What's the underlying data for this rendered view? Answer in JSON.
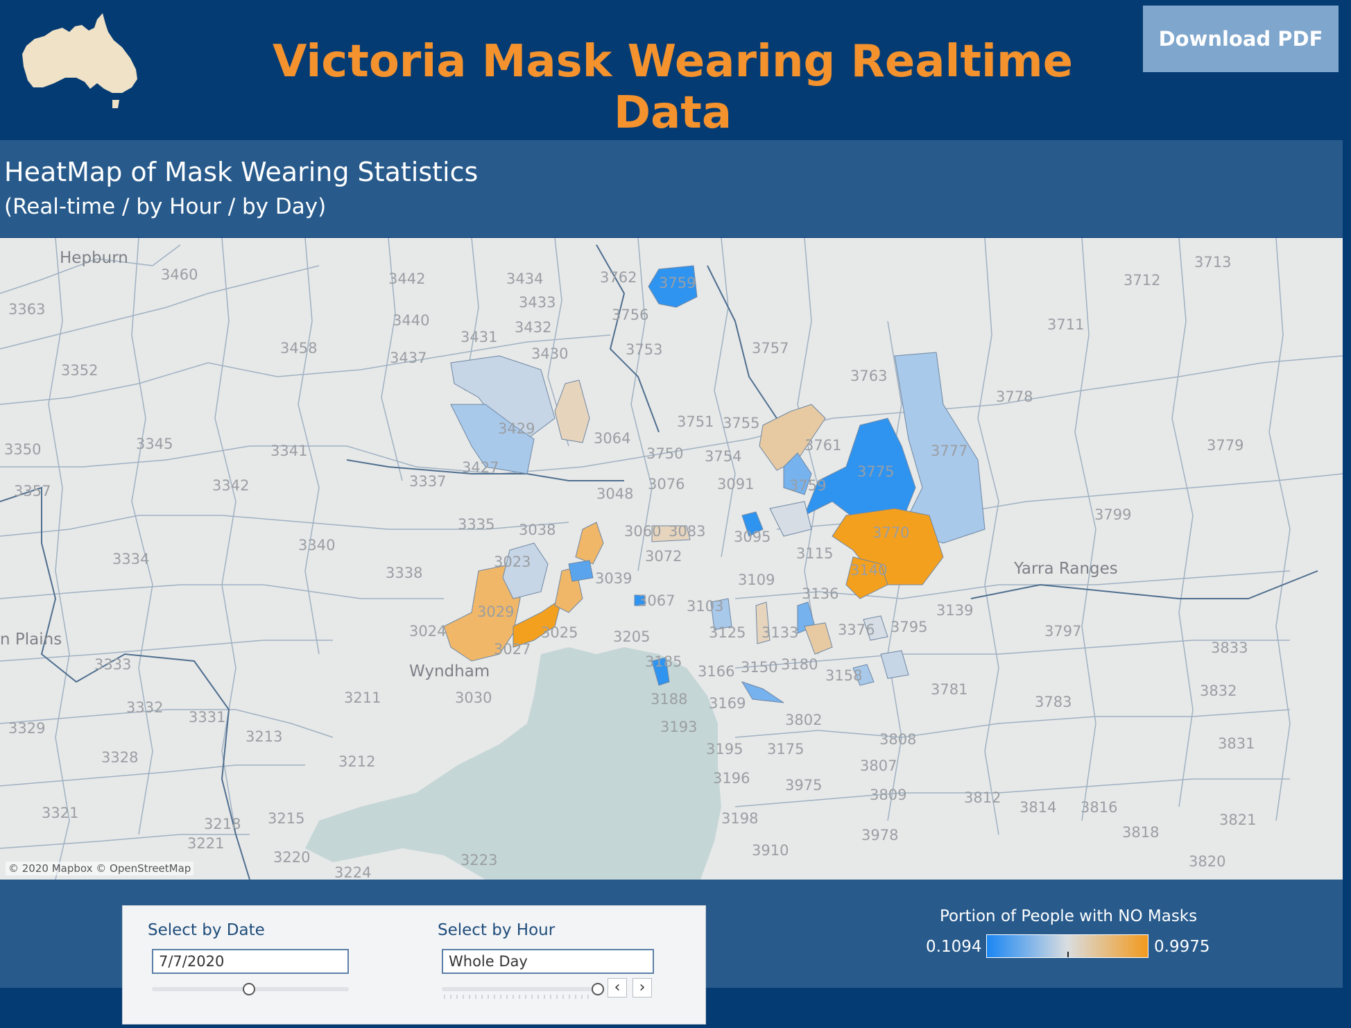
{
  "header": {
    "title": "Victoria Mask Wearing Realtime Data",
    "download_label": "Download PDF",
    "logo": "australia-map-logo",
    "colors": {
      "background": "#053b73",
      "title": "#f4922e",
      "button": "#7fa6cc"
    }
  },
  "panel": {
    "title": "HeatMap of Mask Wearing Statistics",
    "subtitle": "(Real-time / by Hour / by Day)"
  },
  "map": {
    "attribution": "© 2020 Mapbox © OpenStreetMap",
    "place_names": [
      "Hepburn",
      "Wyndham",
      "Yarra Ranges",
      "n Plains"
    ],
    "postcodes": [
      "3460",
      "3442",
      "3434",
      "3762",
      "3759",
      "3363",
      "3440",
      "3433",
      "3756",
      "3431",
      "3432",
      "3458",
      "3437",
      "3430",
      "3753",
      "3757",
      "3711",
      "3712",
      "3713",
      "3352",
      "3763",
      "3778",
      "3429",
      "3751",
      "3755",
      "3779",
      "3345",
      "3341",
      "3064",
      "3750",
      "3754",
      "3761",
      "3775",
      "3777",
      "3350",
      "3337",
      "3427",
      "3076",
      "3091",
      "3757",
      "3342",
      "3048",
      "3759",
      "3799",
      "3357",
      "3335",
      "3038",
      "3060",
      "3083",
      "3095",
      "3770",
      "3340",
      "3023",
      "3072",
      "3115",
      "3334",
      "3338",
      "3039",
      "3109",
      "3136",
      "3140",
      "3029",
      "3024",
      "3067",
      "3103",
      "3139",
      "3795",
      "3025",
      "3125",
      "3133",
      "3376",
      "3797",
      "3027",
      "3205",
      "3150",
      "3180",
      "3158",
      "3833",
      "3333",
      "3185",
      "3166",
      "3781",
      "3832",
      "3211",
      "3030",
      "3188",
      "3169",
      "3783",
      "3332",
      "3331",
      "3802",
      "3329",
      "3213",
      "3193",
      "3808",
      "3831",
      "3328",
      "3212",
      "3195",
      "3175",
      "3807",
      "3196",
      "3975",
      "3812",
      "3814",
      "3816",
      "3809",
      "3321",
      "3218",
      "3215",
      "3198",
      "3978",
      "3818",
      "3821",
      "3221",
      "3220",
      "3223",
      "3224",
      "3910",
      "3820"
    ],
    "regions": [
      {
        "postcode": "3759",
        "value": 0.15
      },
      {
        "postcode": "3429",
        "value": 0.42
      },
      {
        "postcode": "3064",
        "value": 0.72
      },
      {
        "postcode": "3427",
        "value": 0.38
      },
      {
        "postcode": "3761",
        "value": 0.72
      },
      {
        "postcode": "3775",
        "value": 0.18
      },
      {
        "postcode": "3777",
        "value": 0.33
      },
      {
        "postcode": "3770",
        "value": 0.97
      },
      {
        "postcode": "3140",
        "value": 0.95
      },
      {
        "postcode": "3029",
        "value": 0.85
      },
      {
        "postcode": "3027",
        "value": 0.95
      },
      {
        "postcode": "3023",
        "value": 0.4
      },
      {
        "postcode": "3038",
        "value": 0.9
      },
      {
        "postcode": "3125",
        "value": 0.35
      },
      {
        "postcode": "3133",
        "value": 0.7
      },
      {
        "postcode": "3185",
        "value": 0.15
      }
    ],
    "colors": {
      "water": "#c5d6d6",
      "land": "#e7e8e8",
      "boundary": "#9fb1c2"
    }
  },
  "controls": {
    "date_label": "Select by Date",
    "date_value": "7/7/2020",
    "hour_label": "Select by Hour",
    "hour_value": "Whole Day",
    "prev_icon": "chevron-left-icon",
    "next_icon": "chevron-right-icon"
  },
  "legend": {
    "title": "Portion of People with NO Masks",
    "min": "0.1094",
    "max": "0.9975",
    "colors": {
      "low": "#1a86f3",
      "mid": "#d9dde0",
      "high": "#f29a1e"
    }
  }
}
